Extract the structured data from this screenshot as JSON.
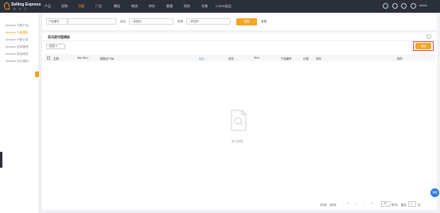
{
  "brand": {
    "name": "Selling Express",
    "subtitle": "数 · 智 · 云"
  },
  "nav": [
    "产品",
    "采购",
    "刊登",
    "广告",
    "赠送",
    "物流",
    "库存",
    "客服",
    "财务",
    "仓储",
    "CGFM选品"
  ],
  "nav_active_index": 2,
  "user": {
    "name": "admin"
  },
  "sidebar": {
    "header": "Amazon",
    "items": [
      "Amazon 刊登产品",
      "Amazon 刊登模板",
      "Amazon 刊登记录",
      "Amazon 变体管理",
      "Amazon 批量修改",
      "Amazon 定价规则"
    ],
    "active_index": 1
  },
  "filters": {
    "type_select": "产品编号",
    "type_input_placeholder": "",
    "store_label": "站点",
    "store_select": "--请选择--",
    "status_label": "状态",
    "status_select": "--请选择--",
    "search_label": "搜索",
    "reset_label": "重置"
  },
  "card": {
    "title": "亚马逊刊登模板",
    "batch_label": "批量",
    "add_label": "添加"
  },
  "table": {
    "headers": [
      "主图",
      "Site SKU",
      "模板名/Title",
      "站点",
      "状态",
      "SKU",
      "产品编号",
      "价格",
      "库存",
      "操作"
    ]
  },
  "empty": {
    "text": "暂无数据"
  },
  "pagination": {
    "total_text": "共0条",
    "pages_text": "共0页",
    "page_size": "20",
    "per_page_label": "条/页",
    "goto_label": "跳至",
    "page_value": "1",
    "page_suffix": "页"
  },
  "float_button": "客服"
}
